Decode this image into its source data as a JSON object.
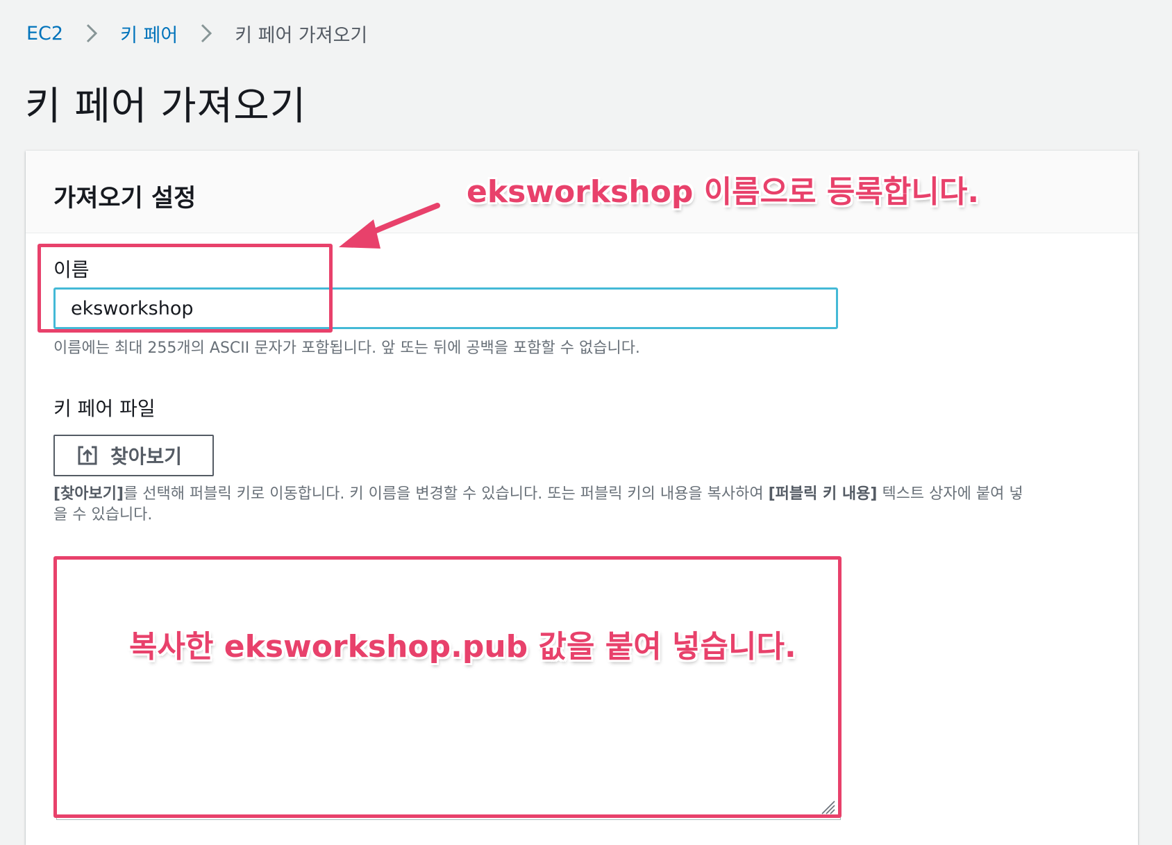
{
  "breadcrumb": {
    "items": [
      "EC2",
      "키 페어",
      "키 페어 가져오기"
    ]
  },
  "page": {
    "title": "키 페어 가져오기"
  },
  "panel": {
    "title": "가져오기 설정"
  },
  "name_field": {
    "label": "이름",
    "value": "eksworkshop",
    "hint": "이름에는 최대 255개의 ASCII 문자가 포함됩니다. 앞 또는 뒤에 공백을 포함할 수 없습니다."
  },
  "key_file": {
    "label": "키 페어 파일",
    "browse_button": "찾아보기",
    "browse_icon": "upload-icon",
    "hint_part1": "[찾아보기]",
    "hint_part2": "를 선택해 퍼블릭 키로 이동합니다. 키 이름을 변경할 수 있습니다. 또는 퍼블릭 키의 내용을 복사하여 ",
    "hint_part3": "[퍼블릭 키 내용]",
    "hint_part4": " 텍스트 상자에 붙여 넣",
    "hint_line2": "을 수 있습니다."
  },
  "public_key_textarea": {
    "value": ""
  },
  "annotations": {
    "name_callout": "eksworkshop 이름으로 등록합니다.",
    "textarea_callout": "복사한 eksworkshop.pub 값을 붙여 넣습니다."
  },
  "colors": {
    "link": "#0073bb",
    "annotation": "#e8416b",
    "input_focus": "#44b9d6",
    "background": "#f2f3f3"
  }
}
